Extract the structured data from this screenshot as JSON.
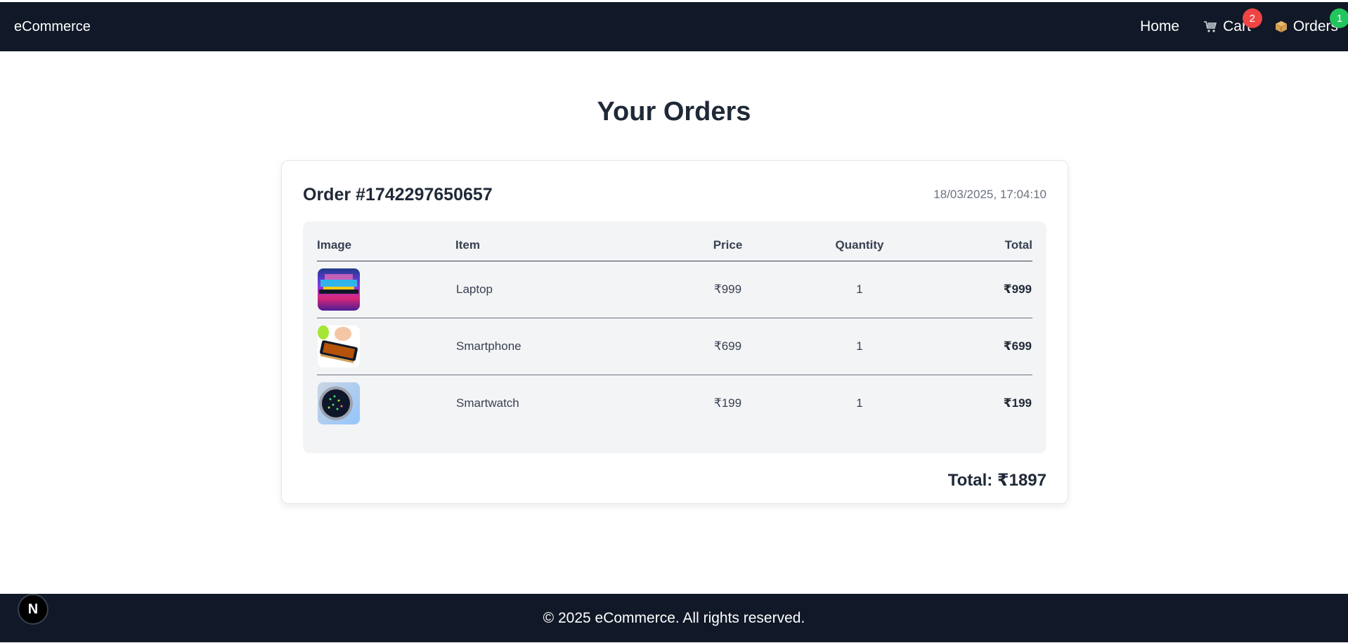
{
  "nav": {
    "brand": "eCommerce",
    "links": [
      {
        "label": "Home",
        "icon": ""
      },
      {
        "label": "Cart",
        "icon": "cart-icon",
        "badge": "2",
        "badge_color": "#ef4444"
      },
      {
        "label": "Orders",
        "icon": "package-icon",
        "badge": "1",
        "badge_color": "#22c55e"
      }
    ]
  },
  "page": {
    "title": "Your Orders"
  },
  "order": {
    "id_label": "Order #1742297650657",
    "date": "18/03/2025, 17:04:10",
    "columns": [
      "Image",
      "Item",
      "Price",
      "Quantity",
      "Total"
    ],
    "items": [
      {
        "name": "Laptop",
        "price": "₹999",
        "quantity": "1",
        "total": "₹999",
        "image": "laptop-image"
      },
      {
        "name": "Smartphone",
        "price": "₹699",
        "quantity": "1",
        "total": "₹699",
        "image": "smartphone-image"
      },
      {
        "name": "Smartwatch",
        "price": "₹199",
        "quantity": "1",
        "total": "₹199",
        "image": "smartwatch-image"
      }
    ],
    "grand_total": "Total: ₹1897"
  },
  "footer": {
    "text": "© 2025 eCommerce. All rights reserved.",
    "dev_badge": "N"
  },
  "colors": {
    "navbar_bg": "#111827",
    "cart_badge": "#ef4444",
    "orders_badge": "#22c55e",
    "table_bg": "#f3f4f6"
  }
}
